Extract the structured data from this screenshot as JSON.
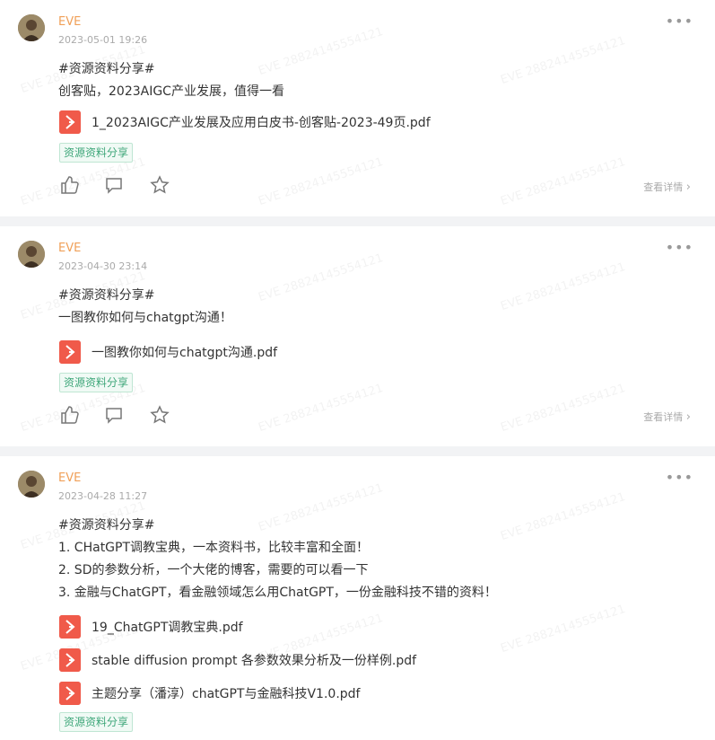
{
  "watermark": "EVE 28824145554121",
  "posts": [
    {
      "author": "EVE",
      "time": "2023-05-01 19:26",
      "lines": [
        "#资源资料分享#",
        "创客贴，2023AIGC产业发展，值得一看"
      ],
      "files": [
        "1_2023AIGC产业发展及应用白皮书-创客贴-2023-49页.pdf"
      ],
      "tag": "资源资料分享",
      "detail": "查看详情"
    },
    {
      "author": "EVE",
      "time": "2023-04-30 23:14",
      "lines": [
        "#资源资料分享#",
        "一图教你如何与chatgpt沟通！"
      ],
      "files": [
        "一图教你如何与chatgpt沟通.pdf"
      ],
      "tag": "资源资料分享",
      "detail": "查看详情"
    },
    {
      "author": "EVE",
      "time": "2023-04-28 11:27",
      "lines": [
        "#资源资料分享#",
        "1. CHatGPT调教宝典，一本资料书，比较丰富和全面！",
        "2. SD的参数分析，一个大佬的博客，需要的可以看一下",
        "3. 金融与ChatGPT，看金融领域怎么用ChatGPT，一份金融科技不错的资料！"
      ],
      "files": [
        "19_ChatGPT调教宝典.pdf",
        "stable diffusion prompt 各参数效果分析及一份样例.pdf",
        "主题分享（潘淳）chatGPT与金融科技V1.0.pdf"
      ],
      "tag": "资源资料分享"
    }
  ],
  "colors": {
    "author": "#f0a058",
    "pdf_icon": "#f05a4a",
    "tag_text": "#3fa77a",
    "page_bg": "#f2f3f5"
  },
  "icons": {
    "more": "more-dots-icon",
    "like": "thumbs-up-icon",
    "comment": "comment-icon",
    "favorite": "star-icon",
    "file": "pdf-icon",
    "detail_arrow": "chevron-right-icon"
  }
}
